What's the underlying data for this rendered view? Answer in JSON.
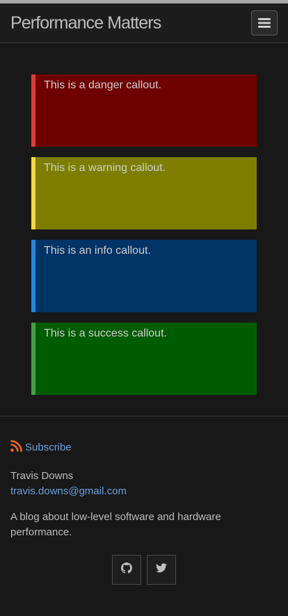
{
  "header": {
    "site_title": "Performance Matters",
    "menu_icon": "hamburger-icon"
  },
  "callouts": [
    {
      "kind": "danger",
      "text": "This is a danger callout.",
      "color": "#6e0000",
      "border": "#e53935"
    },
    {
      "kind": "warning",
      "text": "This is a warning callout.",
      "color": "#7d7d00",
      "border": "#fdd835"
    },
    {
      "kind": "info",
      "text": "This is an info callout.",
      "color": "#003366",
      "border": "#1e88e5"
    },
    {
      "kind": "success",
      "text": "This is a success callout.",
      "color": "#005c00",
      "border": "#43a047"
    }
  ],
  "footer": {
    "subscribe_label": "Subscribe",
    "subscribe_icon": "rss-icon",
    "author_name": "Travis Downs",
    "email": "travis.downs@gmail.com",
    "description": "A blog about low-level software and hardware performance.",
    "social": [
      {
        "name": "github",
        "icon": "github-icon"
      },
      {
        "name": "twitter",
        "icon": "twitter-icon"
      }
    ]
  },
  "colors": {
    "background": "#181818",
    "link": "#6ca0dc",
    "rss": "#f26522"
  }
}
